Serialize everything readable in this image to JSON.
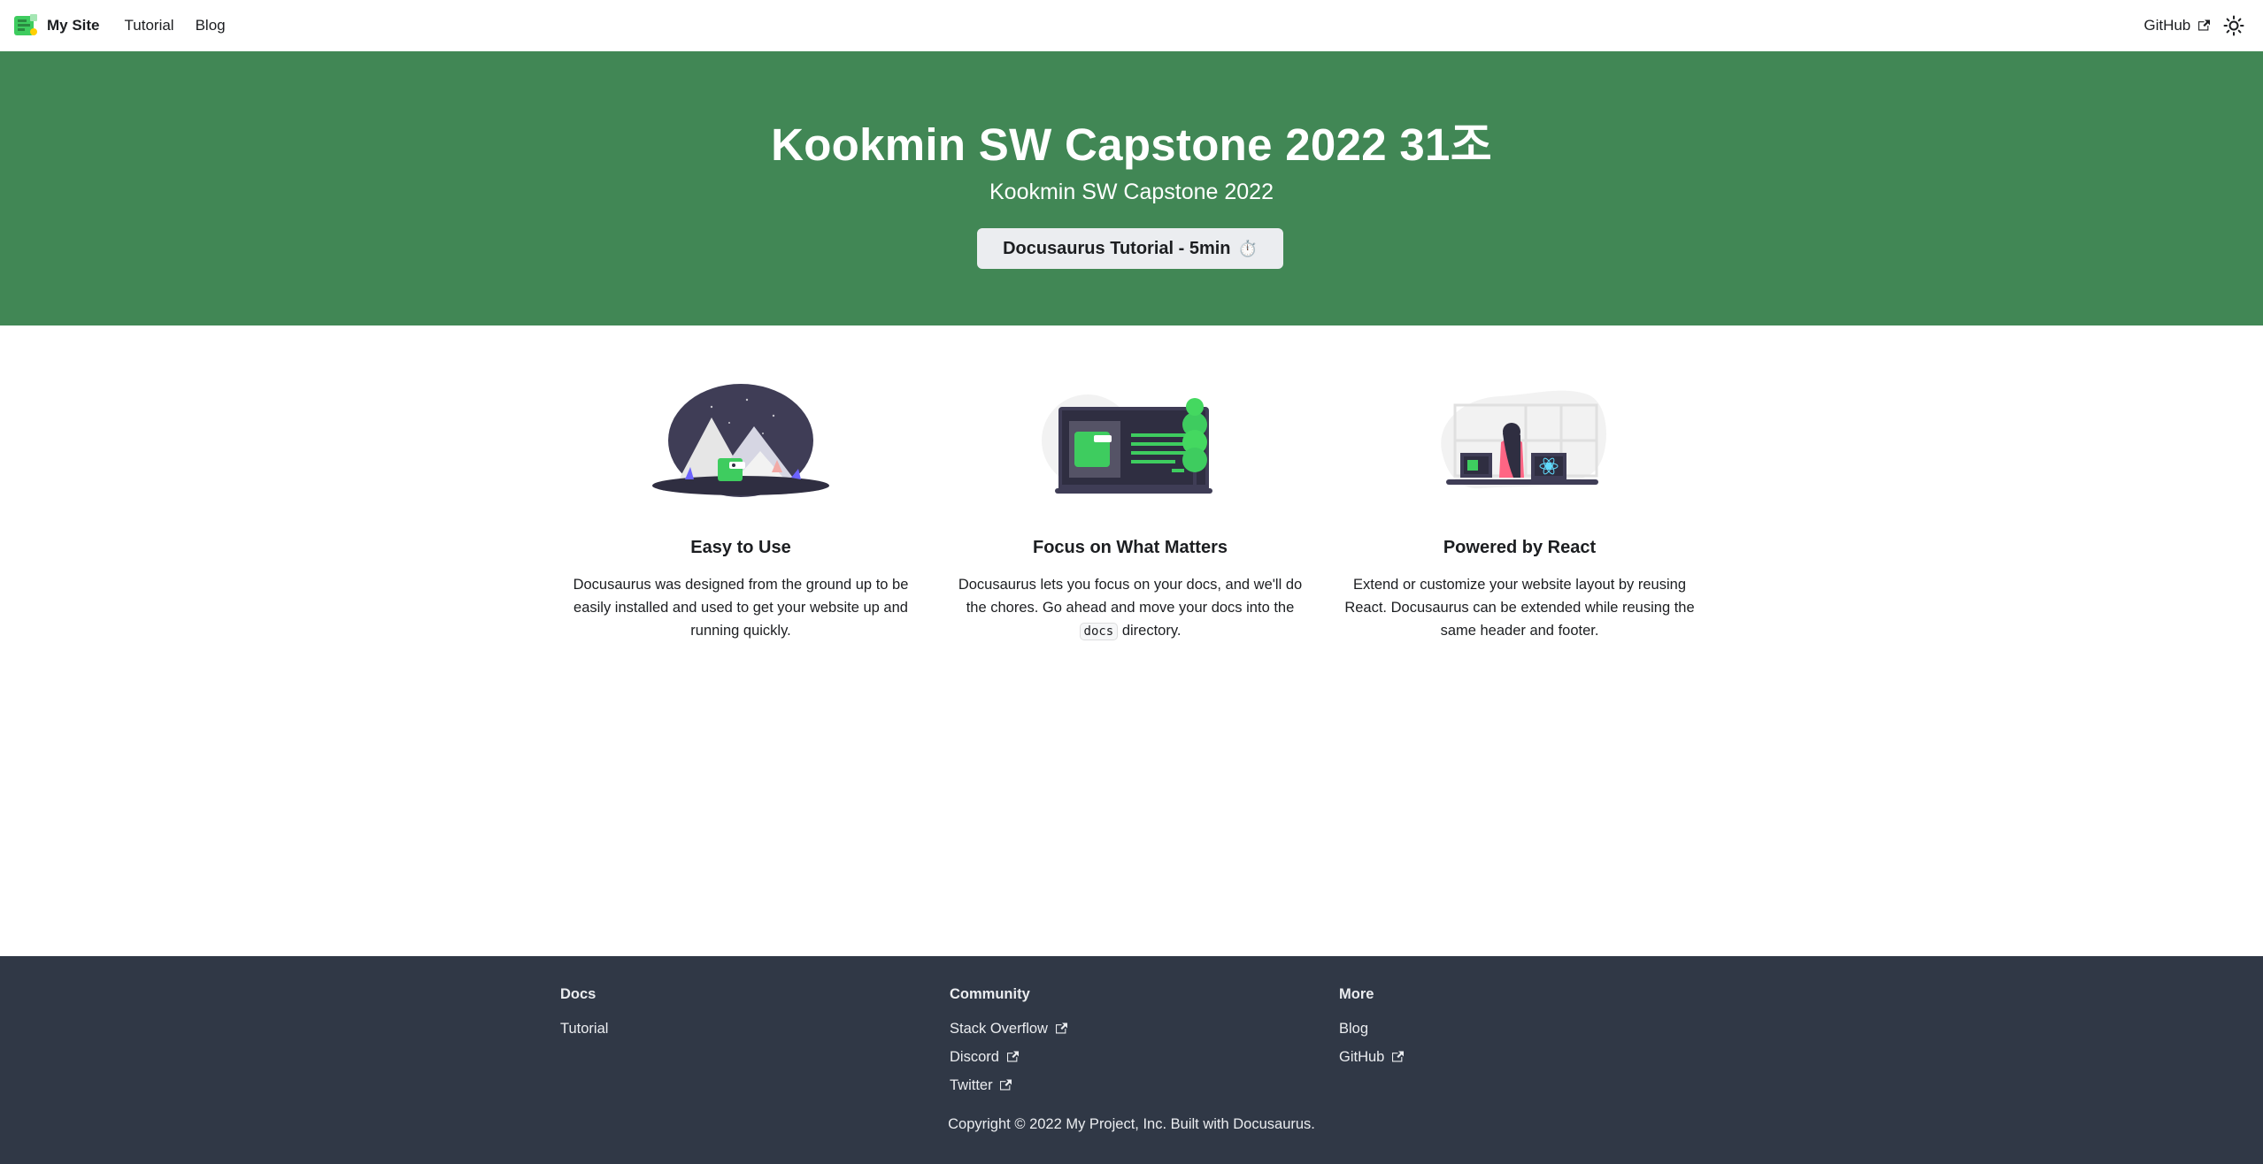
{
  "navbar": {
    "brand_title": "My Site",
    "links": [
      "Tutorial",
      "Blog"
    ],
    "github_label": "GitHub",
    "theme_toggle_icon": "sun-icon"
  },
  "hero": {
    "title": "Kookmin SW Capstone 2022 31조",
    "subtitle": "Kookmin SW Capstone 2022",
    "button_label": "Docusaurus Tutorial - 5min",
    "button_emoji": "⏱️",
    "background_color": "#418755"
  },
  "features": [
    {
      "title": "Easy to Use",
      "description": "Docusaurus was designed from the ground up to be easily installed and used to get your website up and running quickly.",
      "illustration": "mountains-illustration"
    },
    {
      "title": "Focus on What Matters",
      "description_before": "Docusaurus lets you focus on your docs, and we'll do the chores. Go ahead and move your docs into the",
      "description_code": "docs",
      "description_after": "directory.",
      "illustration": "monitor-tree-illustration"
    },
    {
      "title": "Powered by React",
      "description": "Extend or customize your website layout by reusing React. Docusaurus can be extended while reusing the same header and footer.",
      "illustration": "person-computer-illustration"
    }
  ],
  "footer": {
    "columns": [
      {
        "title": "Docs",
        "links": [
          "Tutorial"
        ]
      },
      {
        "title": "Community",
        "links": [
          "Stack Overflow",
          "Discord",
          "Twitter"
        ]
      },
      {
        "title": "More",
        "links": [
          "Blog",
          "GitHub"
        ]
      }
    ],
    "copyright": "Copyright © 2022 My Project, Inc. Built with Docusaurus.",
    "background_color": "#303846"
  }
}
